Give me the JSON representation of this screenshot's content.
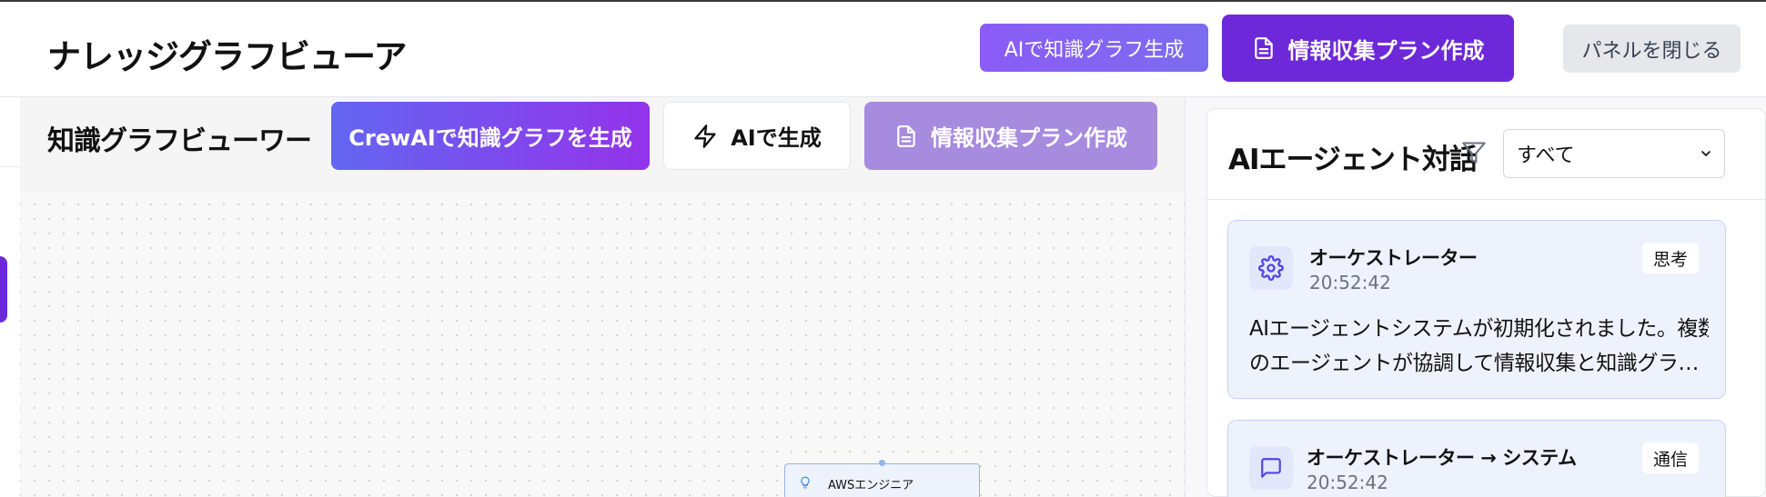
{
  "header": {
    "title": "ナレッジグラフビューア",
    "ai_graph_button": "AIで知識グラフ生成",
    "plan_button": "情報収集プラン作成",
    "close_panel_button": "パネルを閉じる"
  },
  "viewer": {
    "title": "知識グラフビューワー",
    "crew_button": "CrewAIで知識グラフを生成",
    "ai_generate_button": "AIで生成",
    "plan_button": "情報収集プラン作成",
    "node_label": "AWSエンジニア"
  },
  "panel": {
    "title": "AIエージェント対話",
    "filter_value": "すべて",
    "messages": [
      {
        "sender": "オーケストレーター",
        "time": "20:52:42",
        "badge": "思考",
        "text_line1": "AIエージェントシステムが初期化されました。複数",
        "text_line2": "のエージェントが協調して情報収集と知識グラフ…",
        "icon": "gear-icon"
      },
      {
        "sender": "オーケストレーター → システム",
        "time": "20:52:42",
        "badge": "通信",
        "icon": "message-icon"
      }
    ]
  },
  "colors": {
    "primary": "#6d28d9",
    "accent_gradient_start": "#6366f1",
    "accent_gradient_end": "#9333ea",
    "disabled_purple": "#a78bdf",
    "message_bg": "#eef2fc"
  }
}
